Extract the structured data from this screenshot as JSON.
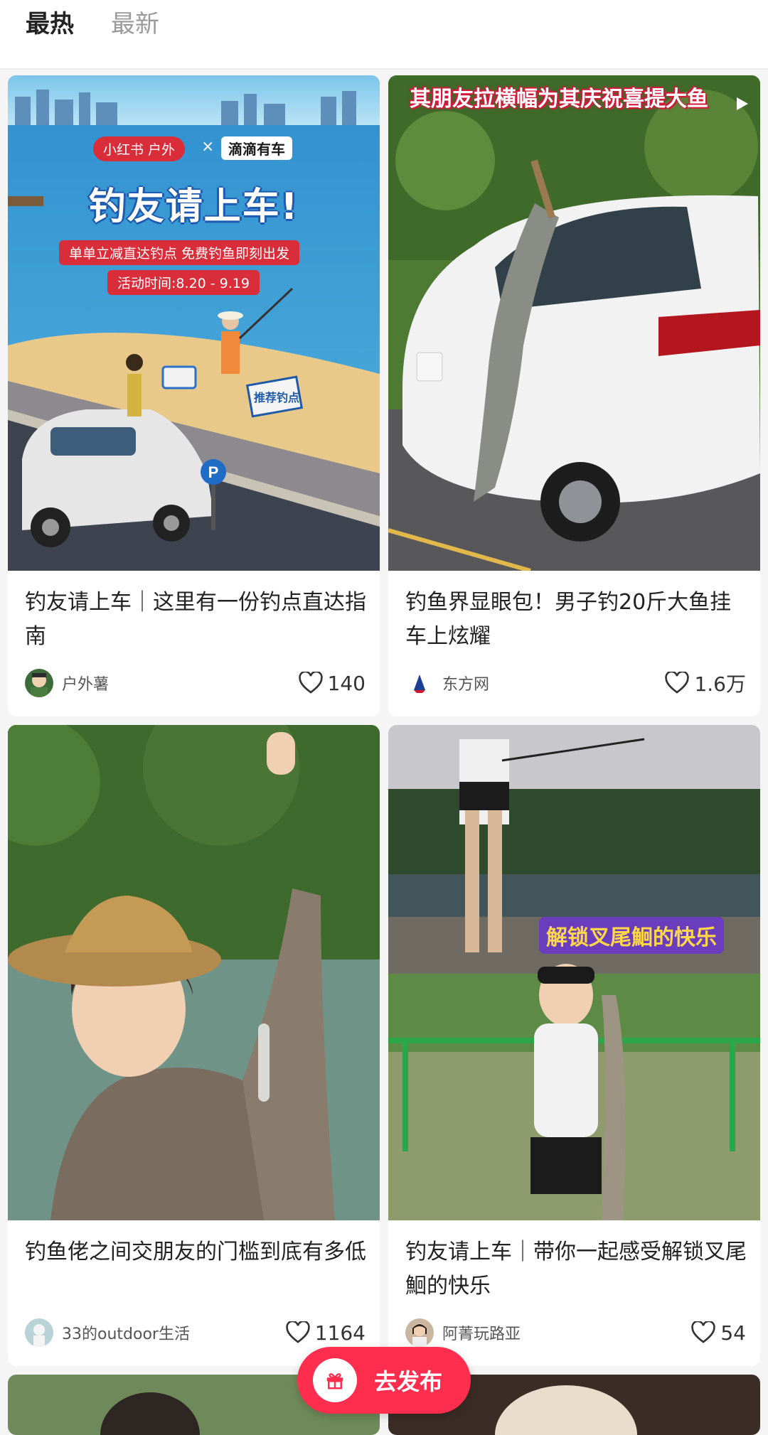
{
  "tabs": {
    "hot": "最热",
    "latest": "最新"
  },
  "cards": [
    {
      "title": "钓友请上车｜这里有一份钓点直达指南",
      "author": "户外薯",
      "likes": "140",
      "poster": {
        "brand_left": "小红书 户外",
        "brand_x": "×",
        "brand_right": "滴滴有车",
        "headline": "钓友请上车!",
        "subline": "单单立减直达钓点 免费钓鱼即刻出发",
        "date": "活动时间:8.20 - 9.19",
        "sign": "推荐钓点"
      }
    },
    {
      "title": "钓鱼界显眼包！男子钓20斤大鱼挂车上炫耀",
      "author": "东方网",
      "likes": "1.6万",
      "overlay": "其朋友拉横幅为其庆祝喜提大鱼"
    },
    {
      "title": "钓鱼佬之间交朋友的门槛到底有多低",
      "author": "33的outdoor生活",
      "likes": "1164"
    },
    {
      "title": "钓友请上车｜带你一起感受解锁叉尾鮰的快乐",
      "author": "阿菁玩路亚",
      "likes": "54",
      "overlay": "解锁叉尾鮰的快乐"
    }
  ],
  "publish_button": {
    "label": "去发布",
    "icon": "gift-icon"
  },
  "colors": {
    "accent": "#ff2e4f",
    "background": "#f5f5f5"
  }
}
